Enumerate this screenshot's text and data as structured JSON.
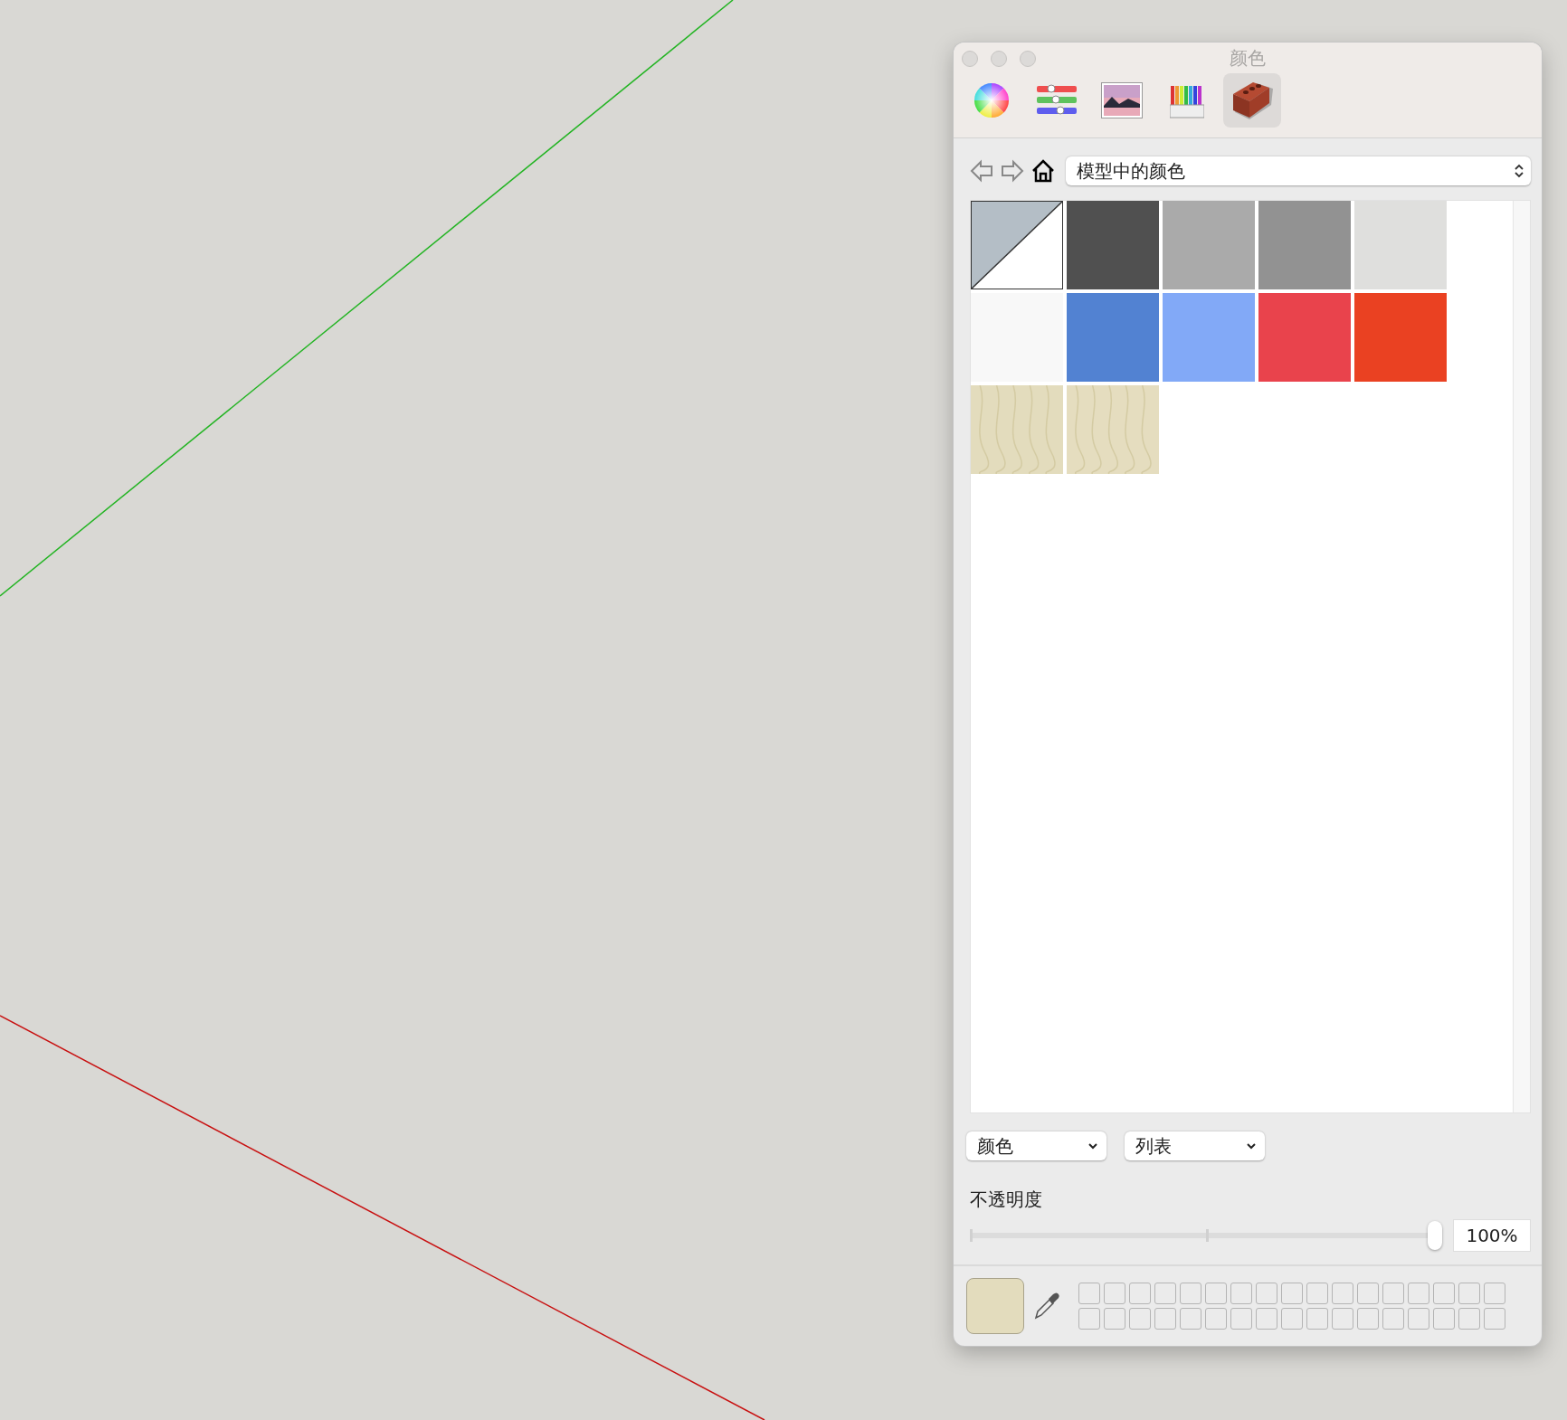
{
  "window": {
    "title": "颜色"
  },
  "toolbar_tabs": [
    {
      "kind": "wheel",
      "selected": false
    },
    {
      "kind": "sliders",
      "selected": false
    },
    {
      "kind": "image",
      "selected": false
    },
    {
      "kind": "pencils",
      "selected": false
    },
    {
      "kind": "brick",
      "selected": true
    }
  ],
  "navigation": {
    "collection": "模型中的颜色"
  },
  "swatches": [
    {
      "kind": "default",
      "selected": true
    },
    {
      "kind": "color",
      "color": "#505050",
      "selected": false
    },
    {
      "kind": "color",
      "color": "#aaaaaa",
      "selected": false
    },
    {
      "kind": "color",
      "color": "#929292",
      "selected": false
    },
    {
      "kind": "color",
      "color": "#dfdfdd",
      "selected": false
    },
    {
      "kind": "color",
      "color": "#f8f8f8",
      "selected": false
    },
    {
      "kind": "color",
      "color": "#5282d2",
      "selected": false
    },
    {
      "kind": "color",
      "color": "#82a9f7",
      "selected": false
    },
    {
      "kind": "color",
      "color": "#e9434c",
      "selected": false
    },
    {
      "kind": "color",
      "color": "#ea4122",
      "selected": false
    },
    {
      "kind": "texture",
      "color": "#e3dcbd",
      "selected": false
    },
    {
      "kind": "texture",
      "color": "#e5ddbf",
      "selected": false
    }
  ],
  "bottom_menus": [
    {
      "value": "颜色"
    },
    {
      "value": "列表"
    }
  ],
  "opacity": {
    "label": "不透明度",
    "level": 1.0,
    "reading": "100%"
  }
}
